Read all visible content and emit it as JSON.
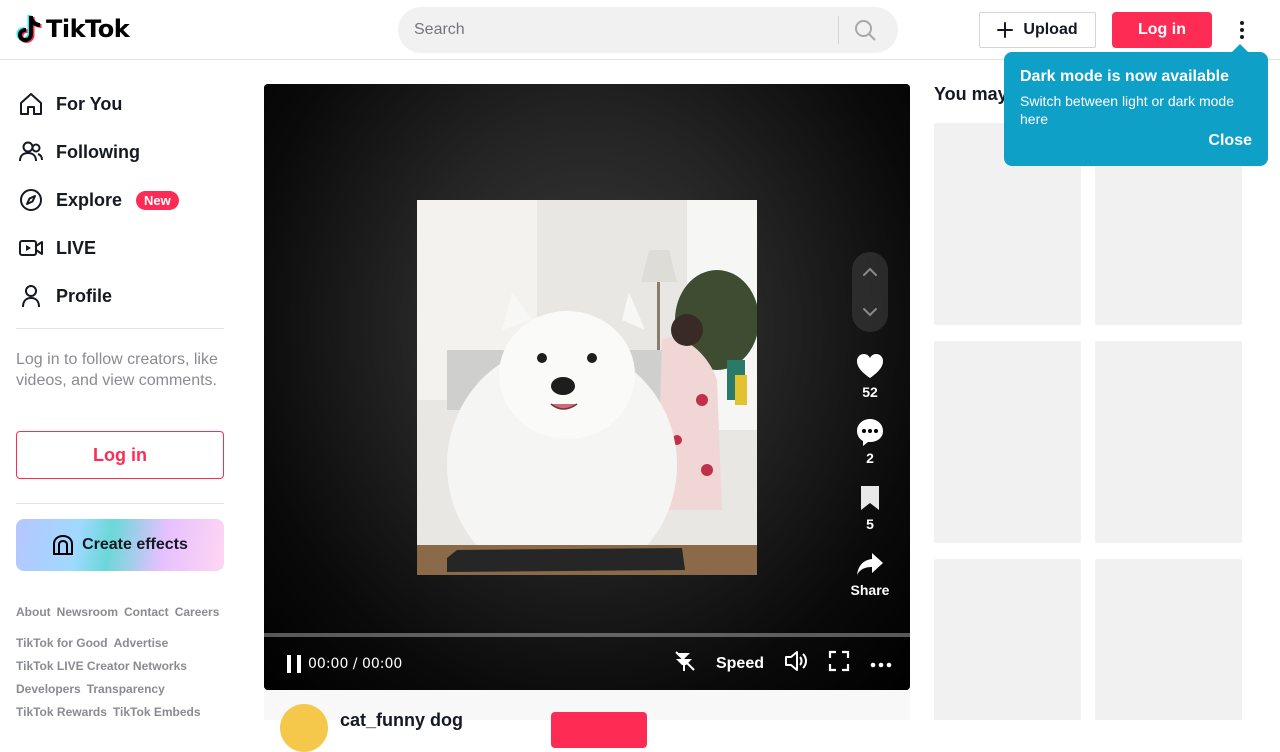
{
  "header": {
    "logo_text": "TikTok",
    "search_placeholder": "Search",
    "upload_label": "Upload",
    "login_label": "Log in"
  },
  "sidebar": {
    "items": [
      {
        "label": "For You",
        "icon": "home-icon"
      },
      {
        "label": "Following",
        "icon": "people-icon"
      },
      {
        "label": "Explore",
        "icon": "compass-icon",
        "badge": "New"
      },
      {
        "label": "LIVE",
        "icon": "live-icon"
      },
      {
        "label": "Profile",
        "icon": "profile-icon"
      }
    ],
    "prompt": "Log in to follow creators, like videos, and view comments.",
    "login_label": "Log in",
    "effects_label": "Create effects",
    "footer_row1": [
      "About",
      "Newsroom",
      "Contact",
      "Careers"
    ],
    "footer_row2": [
      "TikTok for Good",
      "Advertise",
      "TikTok LIVE Creator Networks",
      "Developers",
      "Transparency",
      "TikTok Rewards",
      "TikTok Embeds"
    ]
  },
  "player": {
    "time": "00:00 / 00:00",
    "speed_label": "Speed",
    "likes": "52",
    "comments": "2",
    "saves": "5",
    "share_label": "Share",
    "author": "cat_funny dog"
  },
  "recommend": {
    "title": "You may like"
  },
  "tooltip": {
    "title": "Dark mode is now available",
    "body": "Switch between light or dark mode here",
    "close_label": "Close"
  },
  "colors": {
    "brand": "#fe2c55",
    "tooltip": "#0fa0c8"
  }
}
